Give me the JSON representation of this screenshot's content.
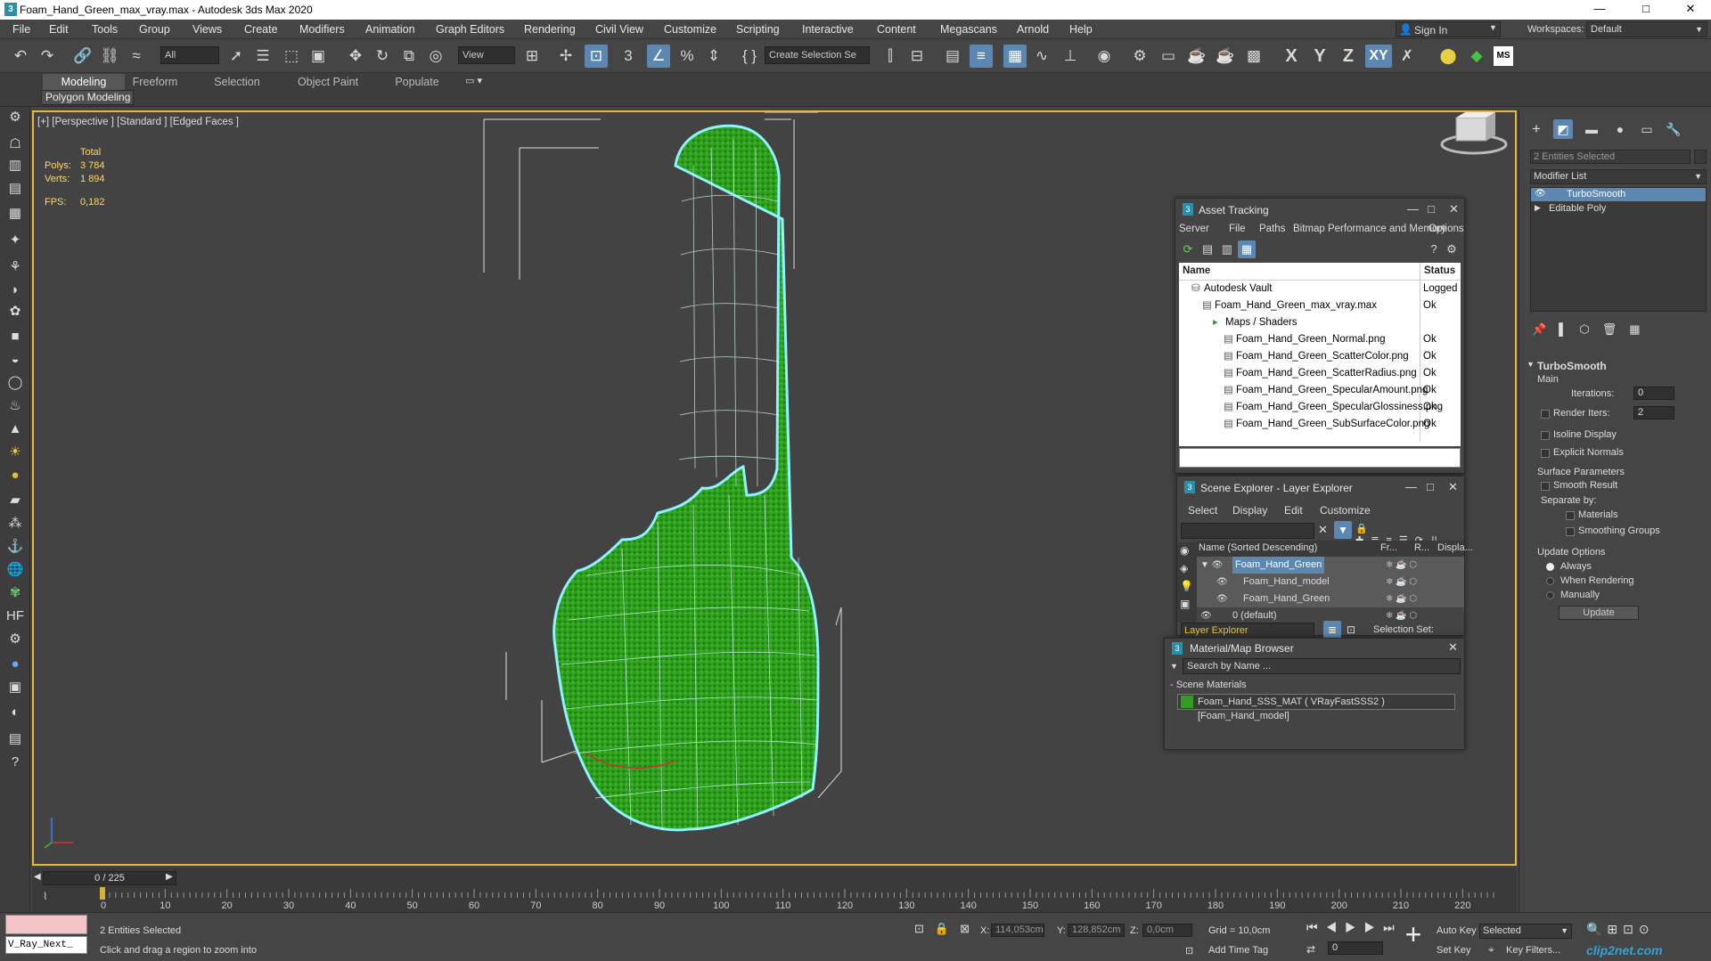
{
  "window": {
    "title": "Foam_Hand_Green_max_vray.max - Autodesk 3ds Max 2020",
    "min": "—",
    "max": "□",
    "close": "✕",
    "app_icon": "3"
  },
  "menu": [
    "File",
    "Edit",
    "Tools",
    "Group",
    "Views",
    "Create",
    "Modifiers",
    "Animation",
    "Graph Editors",
    "Rendering",
    "Civil View",
    "Customize",
    "Scripting",
    "Interactive",
    "Content",
    "Megascans",
    "Arnold",
    "Help"
  ],
  "signin": {
    "label": "Sign In"
  },
  "workspaces": {
    "label": "Workspaces:",
    "value": "Default"
  },
  "toolbar": {
    "filter": "All",
    "view": "View",
    "selection_set": "Create Selection Se",
    "axis_labels": [
      "X",
      "Y",
      "Z",
      "XY"
    ]
  },
  "ribbon": {
    "tabs": [
      "Modeling",
      "Freeform",
      "Selection",
      "Object Paint",
      "Populate"
    ],
    "subtab": "Polygon Modeling"
  },
  "viewport": {
    "label": "[+] [Perspective ] [Standard ] [Edged Faces ]",
    "stats": {
      "total_label": "Total",
      "polys_label": "Polys:",
      "polys": "3 784",
      "verts_label": "Verts:",
      "verts": "1 894",
      "fps_label": "FPS:",
      "fps": "0,182"
    },
    "mesh_color": "#2ea01e",
    "selection_color": "#7fe8f5"
  },
  "asset_tracking": {
    "title": "Asset Tracking",
    "menu": [
      "Server",
      "File",
      "Paths",
      "Bitmap Performance and Memory",
      "Options"
    ],
    "columns": [
      "Name",
      "Status"
    ],
    "rows": [
      {
        "name": "Autodesk Vault",
        "status": "Logged",
        "indent": 1
      },
      {
        "name": "Foam_Hand_Green_max_vray.max",
        "status": "Ok",
        "indent": 2
      },
      {
        "name": "Maps / Shaders",
        "status": "",
        "indent": 3
      },
      {
        "name": "Foam_Hand_Green_Normal.png",
        "status": "Ok",
        "indent": 4
      },
      {
        "name": "Foam_Hand_Green_ScatterColor.png",
        "status": "Ok",
        "indent": 4
      },
      {
        "name": "Foam_Hand_Green_ScatterRadius.png",
        "status": "Ok",
        "indent": 4
      },
      {
        "name": "Foam_Hand_Green_SpecularAmount.png",
        "status": "Ok",
        "indent": 4
      },
      {
        "name": "Foam_Hand_Green_SpecularGlossiness.png",
        "status": "Ok",
        "indent": 4
      },
      {
        "name": "Foam_Hand_Green_SubSurfaceColor.png",
        "status": "Ok",
        "indent": 4
      }
    ]
  },
  "scene_explorer": {
    "title": "Scene Explorer - Layer Explorer",
    "menu": [
      "Select",
      "Display",
      "Edit",
      "Customize"
    ],
    "columns": [
      "Name (Sorted Descending)",
      "Fr...",
      "R...",
      "Displa..."
    ],
    "rows": [
      {
        "name": "Foam_Hand_Green",
        "indent": 1,
        "selected": true
      },
      {
        "name": "Foam_Hand_model",
        "indent": 2,
        "selected": true
      },
      {
        "name": "Foam_Hand_Green",
        "indent": 2,
        "selected": true
      },
      {
        "name": "0 (default)",
        "indent": 1,
        "selected": false
      }
    ],
    "footer_dropdown": "Layer Explorer",
    "selection_set_label": "Selection Set:"
  },
  "material_browser": {
    "title": "Material/Map Browser",
    "search_placeholder": "Search by Name ...",
    "group": "- Scene Materials",
    "item": "Foam_Hand_SSS_MAT ( VRayFastSSS2 ) [Foam_Hand_model]"
  },
  "command_panel": {
    "selected": "2 Entities Selected",
    "modifier_list": "Modifier List",
    "stack": [
      "TurboSmooth",
      "Editable Poly"
    ],
    "rollout": "TurboSmooth",
    "main": "Main",
    "iterations_label": "Iterations:",
    "iterations": "0",
    "render_iters_label": "Render Iters:",
    "render_iters": "2",
    "isoline": "Isoline Display",
    "explicit": "Explicit Normals",
    "surface": "Surface Parameters",
    "smooth_result": "Smooth Result",
    "separate_by": "Separate by:",
    "materials": "Materials",
    "smoothing_groups": "Smoothing Groups",
    "update_options": "Update Options",
    "always": "Always",
    "when_rendering": "When Rendering",
    "manually": "Manually",
    "update_btn": "Update"
  },
  "timeline": {
    "frame": "0 / 225",
    "ticks": [
      "0",
      "10",
      "20",
      "30",
      "40",
      "50",
      "60",
      "70",
      "80",
      "90",
      "100",
      "110",
      "120",
      "130",
      "140",
      "150",
      "160",
      "170",
      "180",
      "190",
      "200",
      "210",
      "220"
    ],
    "max_frames": 225
  },
  "status": {
    "maxscript": "V_Ray_Next_",
    "selected": "2 Entities Selected",
    "prompt": "Click and drag a region to zoom into",
    "x_label": "X:",
    "x": "114,053cm",
    "y_label": "Y:",
    "y": "128,852cm",
    "z_label": "Z:",
    "z": "0,0cm",
    "grid": "Grid = 10,0cm",
    "add_time_tag": "Add Time Tag",
    "auto_key": "Auto Key",
    "set_key": "Set Key",
    "selected_dd": "Selected",
    "key_filters": "Key Filters...",
    "frame_field": "0"
  },
  "watermark": "clip2net.com"
}
